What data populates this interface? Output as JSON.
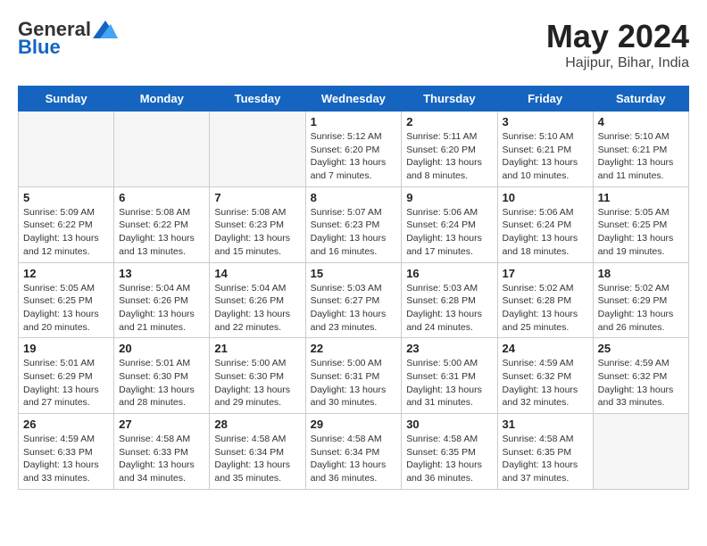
{
  "header": {
    "logo_general": "General",
    "logo_blue": "Blue",
    "month_year": "May 2024",
    "location": "Hajipur, Bihar, India"
  },
  "days_of_week": [
    "Sunday",
    "Monday",
    "Tuesday",
    "Wednesday",
    "Thursday",
    "Friday",
    "Saturday"
  ],
  "weeks": [
    [
      {
        "day": "",
        "info": ""
      },
      {
        "day": "",
        "info": ""
      },
      {
        "day": "",
        "info": ""
      },
      {
        "day": "1",
        "info": "Sunrise: 5:12 AM\nSunset: 6:20 PM\nDaylight: 13 hours\nand 7 minutes."
      },
      {
        "day": "2",
        "info": "Sunrise: 5:11 AM\nSunset: 6:20 PM\nDaylight: 13 hours\nand 8 minutes."
      },
      {
        "day": "3",
        "info": "Sunrise: 5:10 AM\nSunset: 6:21 PM\nDaylight: 13 hours\nand 10 minutes."
      },
      {
        "day": "4",
        "info": "Sunrise: 5:10 AM\nSunset: 6:21 PM\nDaylight: 13 hours\nand 11 minutes."
      }
    ],
    [
      {
        "day": "5",
        "info": "Sunrise: 5:09 AM\nSunset: 6:22 PM\nDaylight: 13 hours\nand 12 minutes."
      },
      {
        "day": "6",
        "info": "Sunrise: 5:08 AM\nSunset: 6:22 PM\nDaylight: 13 hours\nand 13 minutes."
      },
      {
        "day": "7",
        "info": "Sunrise: 5:08 AM\nSunset: 6:23 PM\nDaylight: 13 hours\nand 15 minutes."
      },
      {
        "day": "8",
        "info": "Sunrise: 5:07 AM\nSunset: 6:23 PM\nDaylight: 13 hours\nand 16 minutes."
      },
      {
        "day": "9",
        "info": "Sunrise: 5:06 AM\nSunset: 6:24 PM\nDaylight: 13 hours\nand 17 minutes."
      },
      {
        "day": "10",
        "info": "Sunrise: 5:06 AM\nSunset: 6:24 PM\nDaylight: 13 hours\nand 18 minutes."
      },
      {
        "day": "11",
        "info": "Sunrise: 5:05 AM\nSunset: 6:25 PM\nDaylight: 13 hours\nand 19 minutes."
      }
    ],
    [
      {
        "day": "12",
        "info": "Sunrise: 5:05 AM\nSunset: 6:25 PM\nDaylight: 13 hours\nand 20 minutes."
      },
      {
        "day": "13",
        "info": "Sunrise: 5:04 AM\nSunset: 6:26 PM\nDaylight: 13 hours\nand 21 minutes."
      },
      {
        "day": "14",
        "info": "Sunrise: 5:04 AM\nSunset: 6:26 PM\nDaylight: 13 hours\nand 22 minutes."
      },
      {
        "day": "15",
        "info": "Sunrise: 5:03 AM\nSunset: 6:27 PM\nDaylight: 13 hours\nand 23 minutes."
      },
      {
        "day": "16",
        "info": "Sunrise: 5:03 AM\nSunset: 6:28 PM\nDaylight: 13 hours\nand 24 minutes."
      },
      {
        "day": "17",
        "info": "Sunrise: 5:02 AM\nSunset: 6:28 PM\nDaylight: 13 hours\nand 25 minutes."
      },
      {
        "day": "18",
        "info": "Sunrise: 5:02 AM\nSunset: 6:29 PM\nDaylight: 13 hours\nand 26 minutes."
      }
    ],
    [
      {
        "day": "19",
        "info": "Sunrise: 5:01 AM\nSunset: 6:29 PM\nDaylight: 13 hours\nand 27 minutes."
      },
      {
        "day": "20",
        "info": "Sunrise: 5:01 AM\nSunset: 6:30 PM\nDaylight: 13 hours\nand 28 minutes."
      },
      {
        "day": "21",
        "info": "Sunrise: 5:00 AM\nSunset: 6:30 PM\nDaylight: 13 hours\nand 29 minutes."
      },
      {
        "day": "22",
        "info": "Sunrise: 5:00 AM\nSunset: 6:31 PM\nDaylight: 13 hours\nand 30 minutes."
      },
      {
        "day": "23",
        "info": "Sunrise: 5:00 AM\nSunset: 6:31 PM\nDaylight: 13 hours\nand 31 minutes."
      },
      {
        "day": "24",
        "info": "Sunrise: 4:59 AM\nSunset: 6:32 PM\nDaylight: 13 hours\nand 32 minutes."
      },
      {
        "day": "25",
        "info": "Sunrise: 4:59 AM\nSunset: 6:32 PM\nDaylight: 13 hours\nand 33 minutes."
      }
    ],
    [
      {
        "day": "26",
        "info": "Sunrise: 4:59 AM\nSunset: 6:33 PM\nDaylight: 13 hours\nand 33 minutes."
      },
      {
        "day": "27",
        "info": "Sunrise: 4:58 AM\nSunset: 6:33 PM\nDaylight: 13 hours\nand 34 minutes."
      },
      {
        "day": "28",
        "info": "Sunrise: 4:58 AM\nSunset: 6:34 PM\nDaylight: 13 hours\nand 35 minutes."
      },
      {
        "day": "29",
        "info": "Sunrise: 4:58 AM\nSunset: 6:34 PM\nDaylight: 13 hours\nand 36 minutes."
      },
      {
        "day": "30",
        "info": "Sunrise: 4:58 AM\nSunset: 6:35 PM\nDaylight: 13 hours\nand 36 minutes."
      },
      {
        "day": "31",
        "info": "Sunrise: 4:58 AM\nSunset: 6:35 PM\nDaylight: 13 hours\nand 37 minutes."
      },
      {
        "day": "",
        "info": ""
      }
    ]
  ]
}
